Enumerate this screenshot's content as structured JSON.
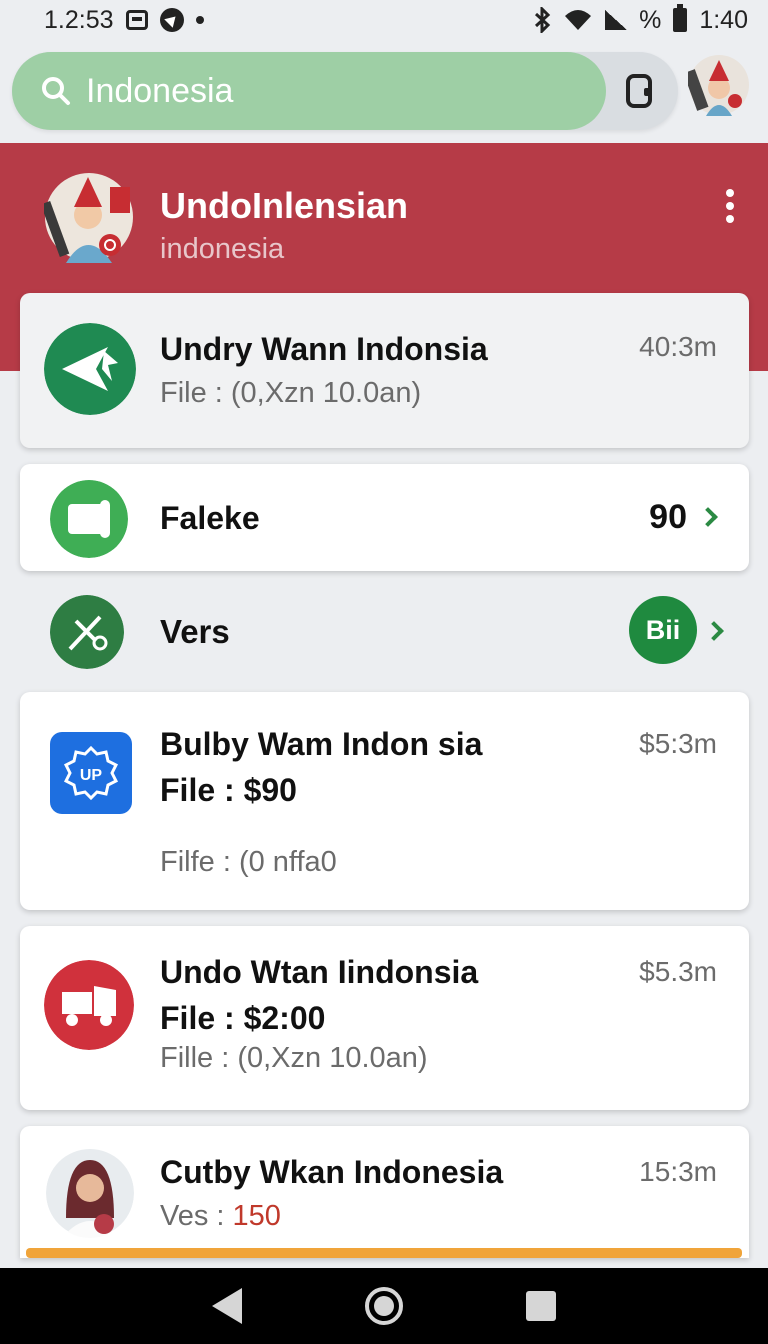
{
  "status_bar": {
    "time_left": "1.2:53",
    "battery_text": "%",
    "time_right": "1:40"
  },
  "search": {
    "value": "Indonesia",
    "icon": "search-icon",
    "trailing_icon": "copy-icon"
  },
  "header": {
    "title": "UndoInlensian",
    "subtitle": "indonesia",
    "menu_icon": "more-vert-icon"
  },
  "list": {
    "item1": {
      "title": "Undry Wann Indonsia",
      "meta": "40:3m",
      "line1": "File : (0,Xzn 10.0an)",
      "icon": "paper-plane-icon"
    },
    "item2": {
      "title": "Faleke",
      "value": "90",
      "icon": "scroll-icon"
    },
    "item3": {
      "title": "Vers",
      "badge": "Bii",
      "icon": "tools-icon"
    },
    "item4": {
      "title": "Bulby Wam Indon sia",
      "meta": "$5:3m",
      "line1": "File : $90",
      "line2": "Filfe : (0 nffa0",
      "icon": "up-badge-icon"
    },
    "item5": {
      "title": "Undo Wtan Iindonsia",
      "meta": "$5.3m",
      "line1": "File : $2:00",
      "line2": "Fille : (0,Xzn 10.0an)",
      "icon": "truck-icon"
    },
    "item6": {
      "title": "Cutby Wkan Indonesia",
      "meta": "15:3m",
      "line1_label": "Ves : ",
      "line1_value": "150",
      "icon": "person-avatar"
    }
  },
  "colors": {
    "header_red": "#b63b47",
    "accent_green": "#1f8a52",
    "search_green": "#9ecfa5",
    "blue": "#1e6fe0",
    "red_icon": "#d0313c",
    "progress_orange": "#f0a43a",
    "value_red": "#c0392b"
  }
}
